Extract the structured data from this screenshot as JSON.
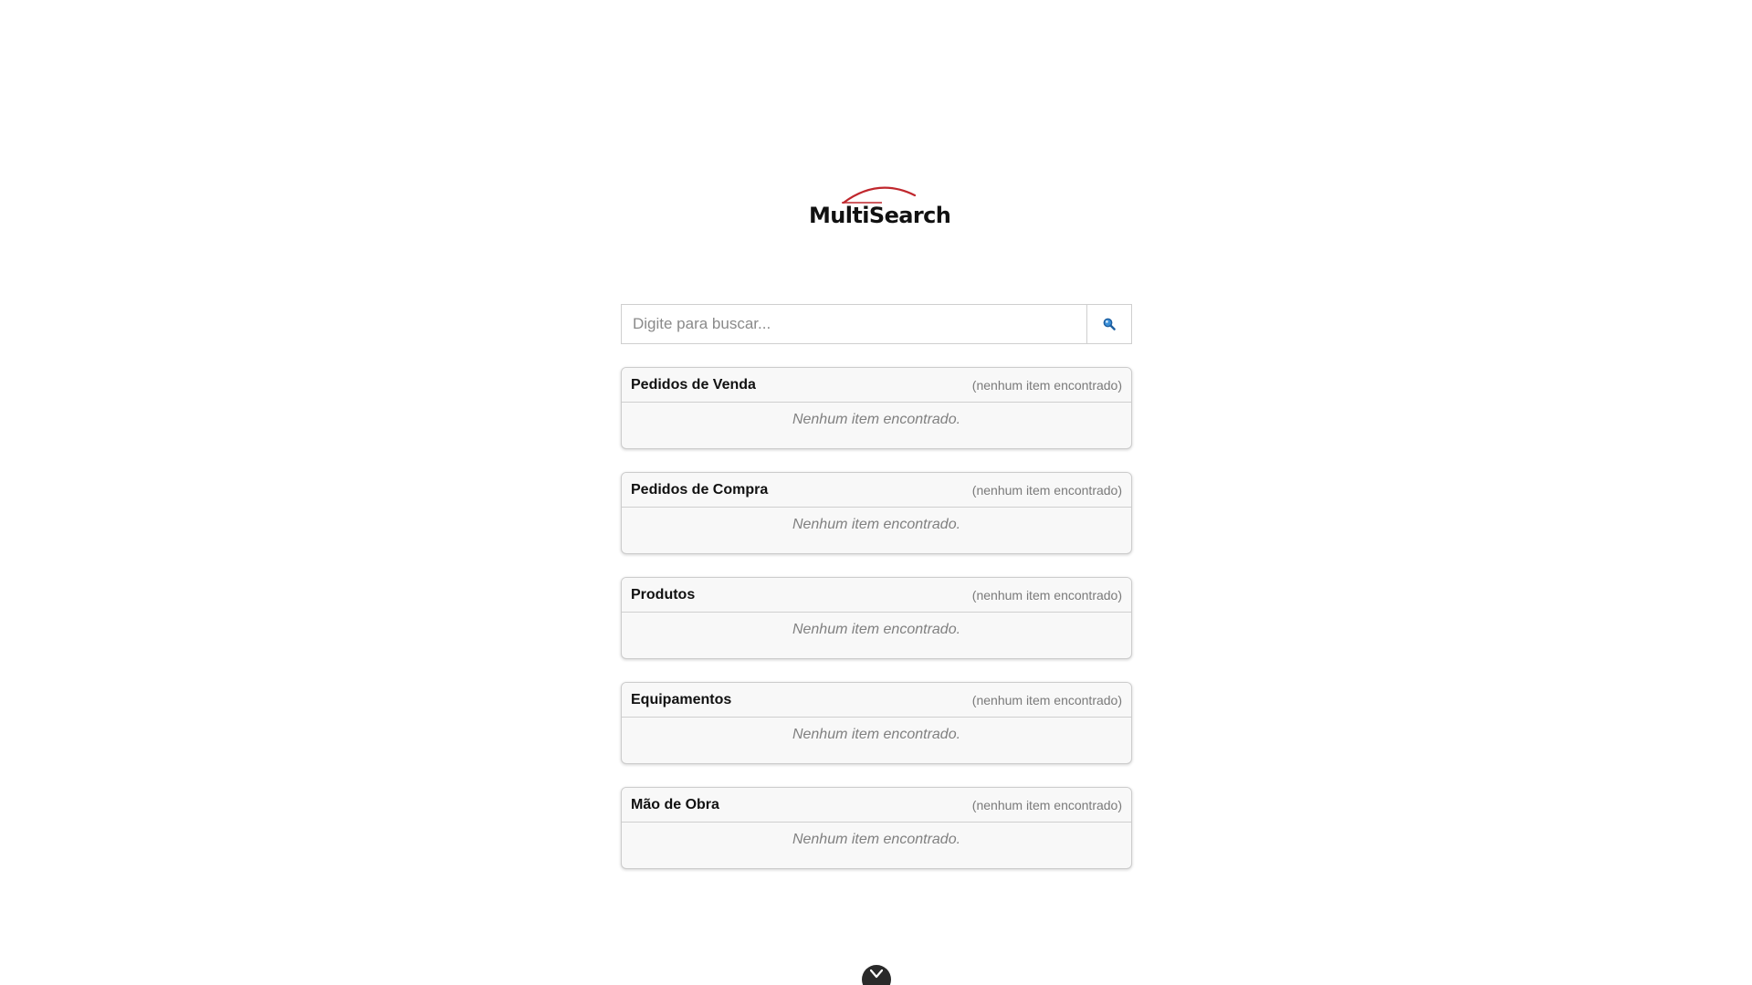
{
  "app": {
    "logo_text": "MultiSearch",
    "logo_accent_color": "#c0272d"
  },
  "search": {
    "placeholder": "Digite para buscar...",
    "value": "",
    "button_icon": "search-icon"
  },
  "sections": [
    {
      "title": "Pedidos de Venda",
      "count_text": "(nenhum item encontrado)",
      "empty_text": "Nenhum item encontrado."
    },
    {
      "title": "Pedidos de Compra",
      "count_text": "(nenhum item encontrado)",
      "empty_text": "Nenhum item encontrado."
    },
    {
      "title": "Produtos",
      "count_text": "(nenhum item encontrado)",
      "empty_text": "Nenhum item encontrado."
    },
    {
      "title": "Equipamentos",
      "count_text": "(nenhum item encontrado)",
      "empty_text": "Nenhum item encontrado."
    },
    {
      "title": "Mão de Obra",
      "count_text": "(nenhum item encontrado)",
      "empty_text": "Nenhum item encontrado."
    }
  ],
  "scroll_button": {
    "icon": "chevron-down-icon"
  }
}
